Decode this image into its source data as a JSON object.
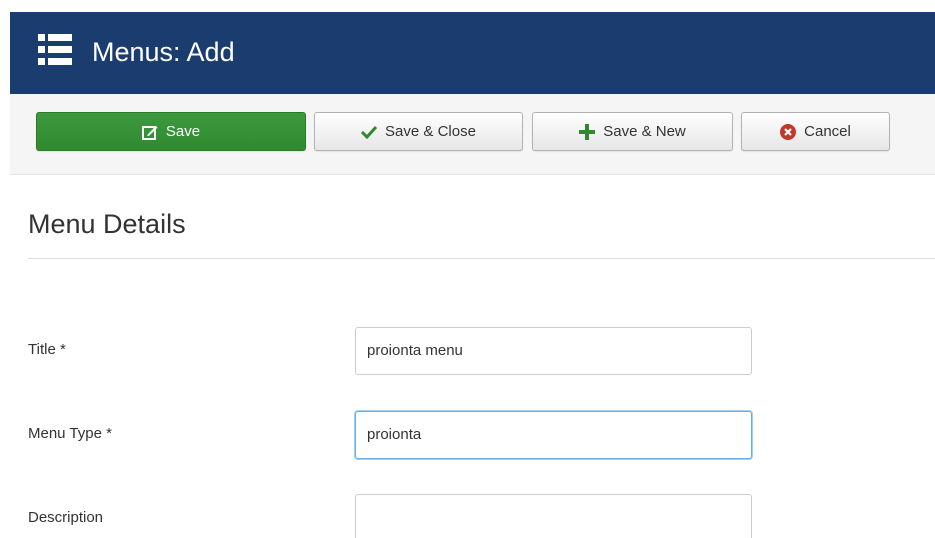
{
  "header": {
    "title": "Menus: Add",
    "icon": "list-icon"
  },
  "toolbar": {
    "save_label": "Save",
    "save_close_label": "Save & Close",
    "save_new_label": "Save & New",
    "cancel_label": "Cancel"
  },
  "form": {
    "section_title": "Menu Details",
    "fields": [
      {
        "label": "Title *",
        "value": "proionta menu"
      },
      {
        "label": "Menu Type *",
        "value": "proionta"
      },
      {
        "label": "Description",
        "value": ""
      }
    ]
  },
  "colors": {
    "header_bg": "#1b3c6e",
    "save_green": "#2f8a2f",
    "cancel_red": "#c0392b"
  }
}
